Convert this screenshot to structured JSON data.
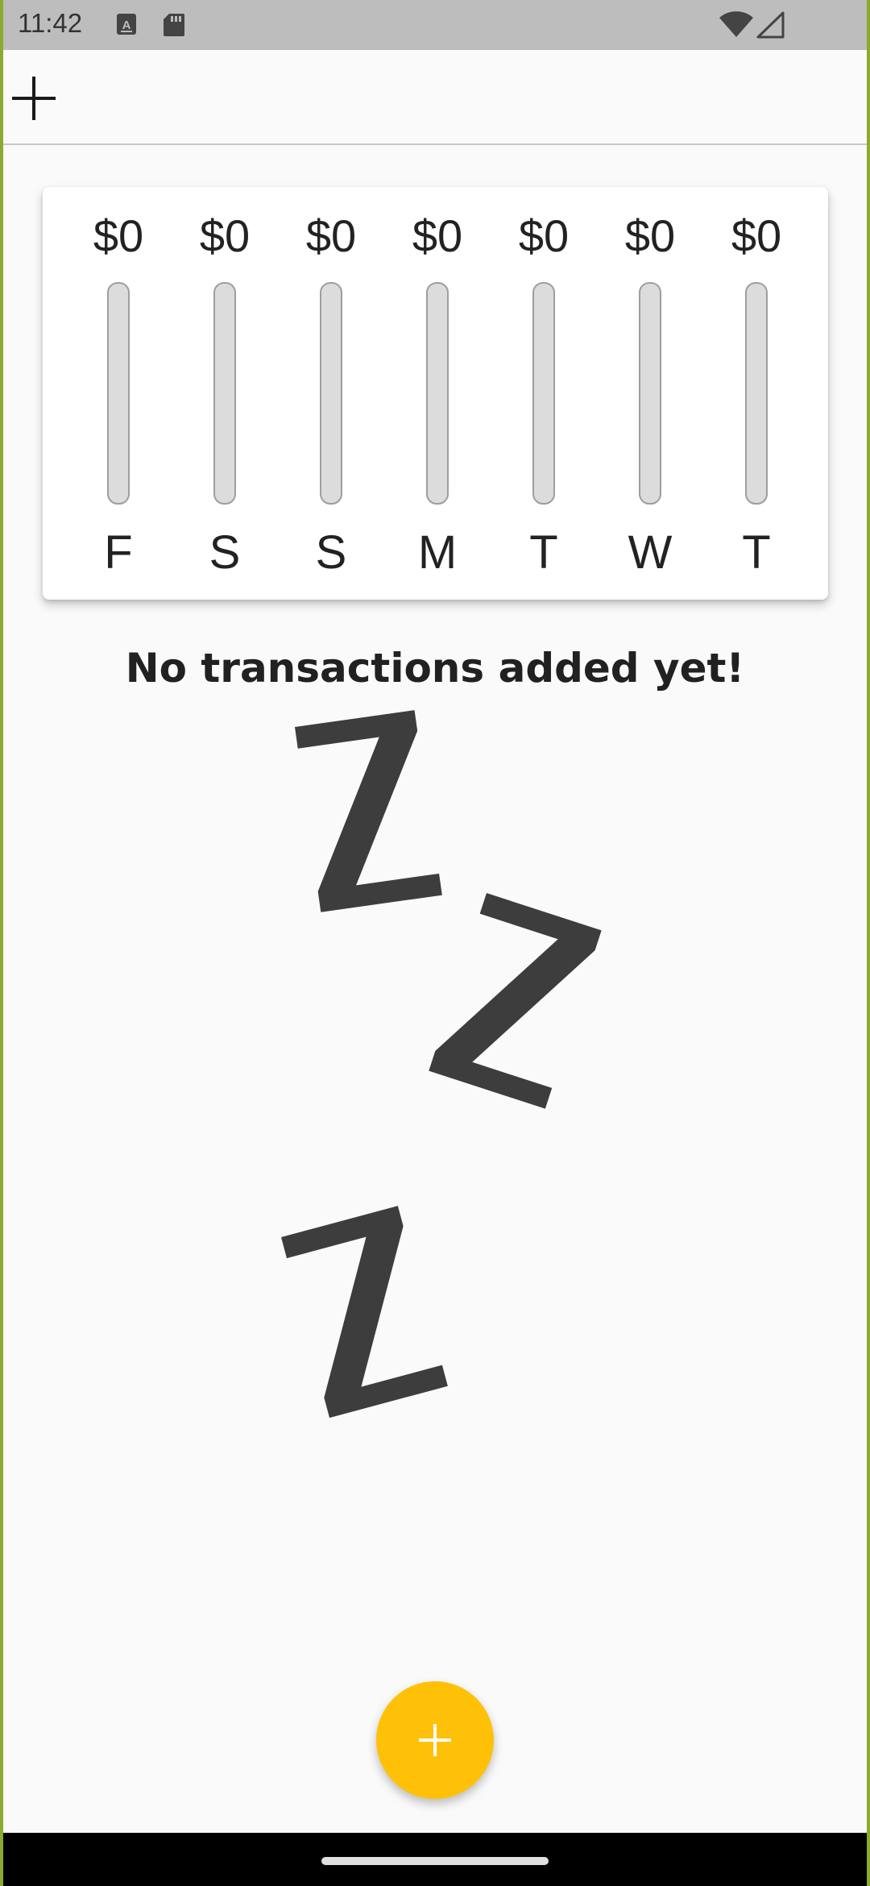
{
  "status_bar": {
    "time": "11:42",
    "icons": [
      "keyboard-a-icon",
      "sd-card-icon",
      "wifi-icon",
      "cellular-signal-icon"
    ]
  },
  "app_bar": {
    "add_icon": "plus-icon"
  },
  "chart": {
    "days": [
      {
        "label": "F",
        "amount": "$0",
        "fill": 0
      },
      {
        "label": "S",
        "amount": "$0",
        "fill": 0
      },
      {
        "label": "S",
        "amount": "$0",
        "fill": 0
      },
      {
        "label": "M",
        "amount": "$0",
        "fill": 0
      },
      {
        "label": "T",
        "amount": "$0",
        "fill": 0
      },
      {
        "label": "W",
        "amount": "$0",
        "fill": 0
      },
      {
        "label": "T",
        "amount": "$0",
        "fill": 0
      }
    ],
    "bar_color": "#dcdcdc",
    "fill_color": "#ffc107"
  },
  "empty_state": {
    "title": "No transactions added yet!",
    "illustration": "sleeping-zzz-icon"
  },
  "fab": {
    "icon": "plus-icon",
    "color": "#ffc107"
  }
}
